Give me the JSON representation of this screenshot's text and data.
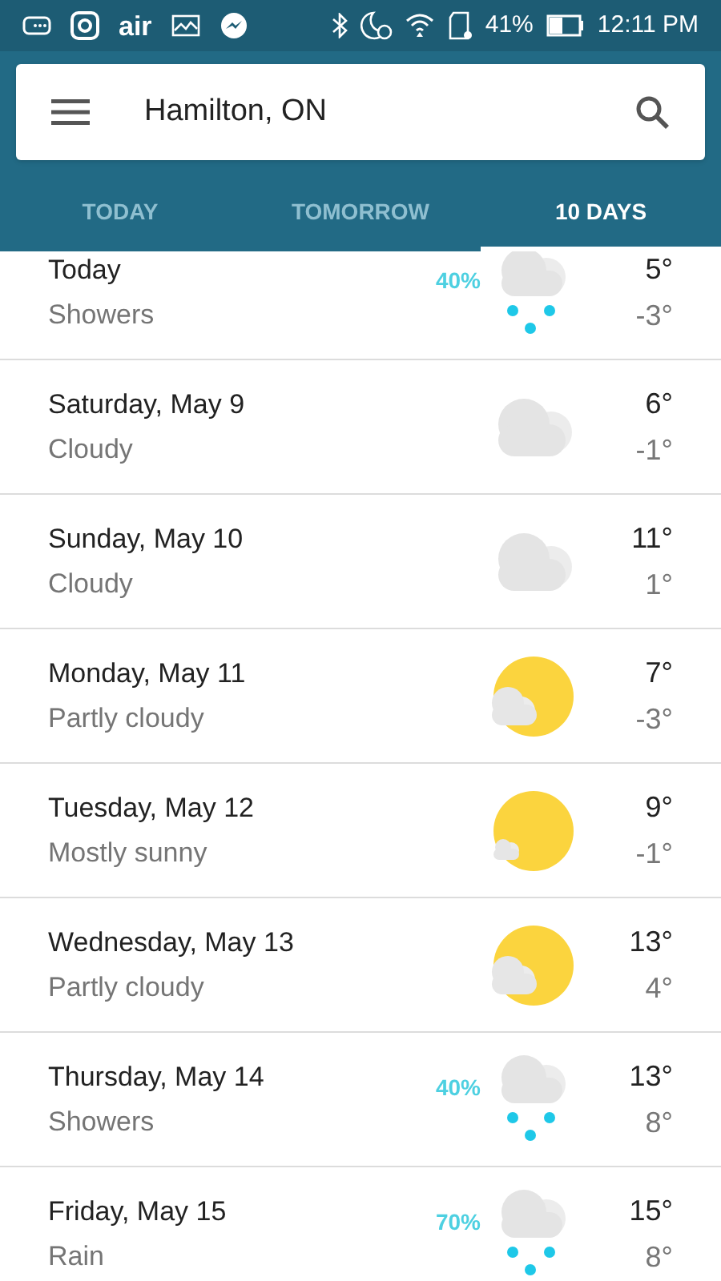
{
  "status_bar": {
    "app_text": "air",
    "battery": "41%",
    "time": "12:11 PM"
  },
  "search": {
    "value": "Hamilton, ON"
  },
  "tabs": [
    {
      "label": "TODAY",
      "selected": false
    },
    {
      "label": "TOMORROW",
      "selected": false
    },
    {
      "label": "10 DAYS",
      "selected": true
    }
  ],
  "days": [
    {
      "day": "Today",
      "condition": "Showers",
      "kind": "rain",
      "precip": "40%",
      "high": "5°",
      "low": "-3°"
    },
    {
      "day": "Saturday, May 9",
      "condition": "Cloudy",
      "kind": "cloudy",
      "high": "6°",
      "low": "-1°"
    },
    {
      "day": "Sunday, May 10",
      "condition": "Cloudy",
      "kind": "cloudy",
      "high": "11°",
      "low": "1°"
    },
    {
      "day": "Monday, May 11",
      "condition": "Partly cloudy",
      "kind": "partly_cloudy",
      "high": "7°",
      "low": "-3°"
    },
    {
      "day": "Tuesday, May 12",
      "condition": "Mostly sunny",
      "kind": "mostly_sunny",
      "high": "9°",
      "low": "-1°"
    },
    {
      "day": "Wednesday, May 13",
      "condition": "Partly cloudy",
      "kind": "partly_cloudy",
      "high": "13°",
      "low": "4°"
    },
    {
      "day": "Thursday, May 14",
      "condition": "Showers",
      "kind": "rain",
      "precip": "40%",
      "high": "13°",
      "low": "8°"
    },
    {
      "day": "Friday, May 15",
      "condition": "Rain",
      "kind": "rain",
      "precip": "70%",
      "high": "15°",
      "low": "8°"
    }
  ]
}
